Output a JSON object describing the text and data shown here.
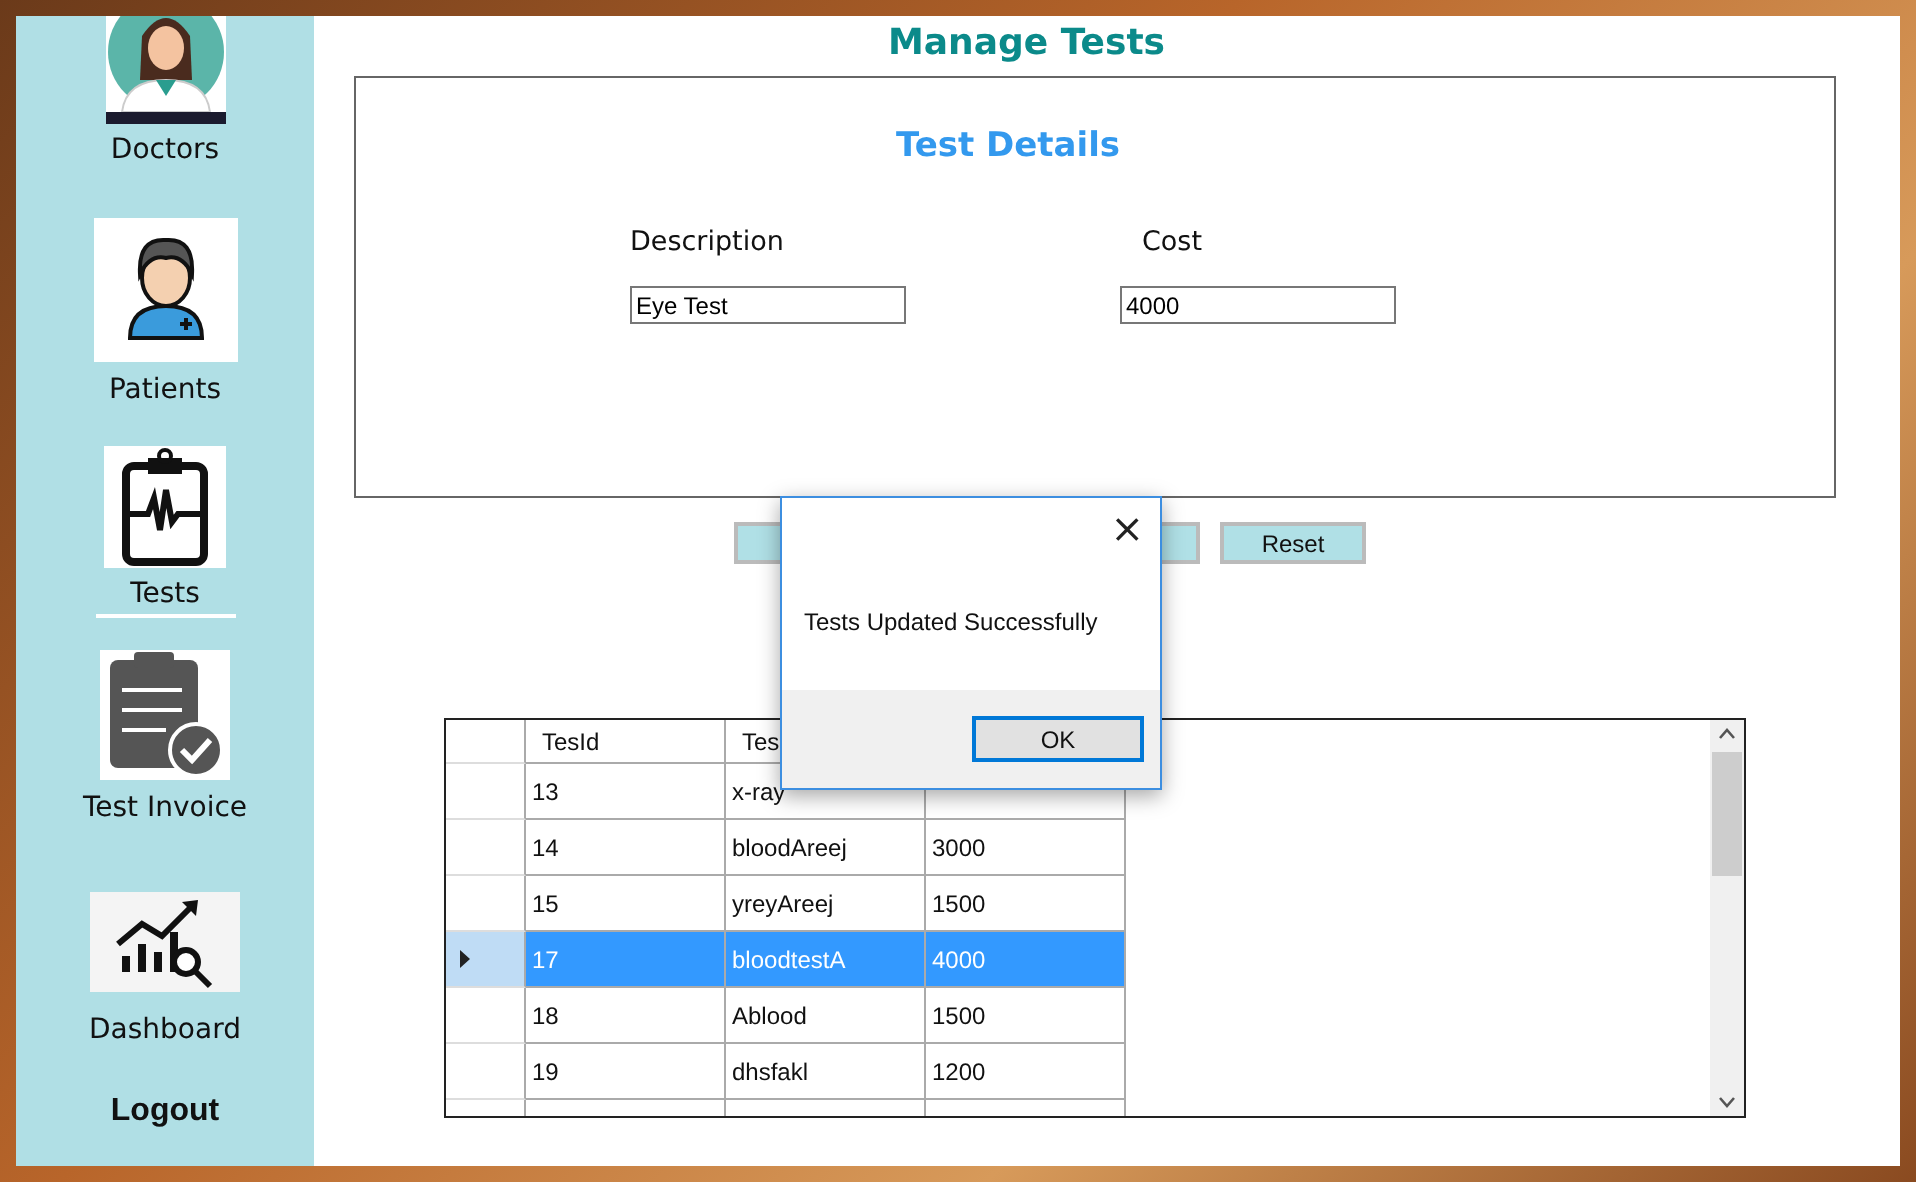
{
  "sidebar": {
    "items": [
      {
        "label": "Doctors",
        "selected": false
      },
      {
        "label": "Patients",
        "selected": false
      },
      {
        "label": "Tests",
        "selected": true
      },
      {
        "label": "Test Invoice",
        "selected": false
      },
      {
        "label": "Dashboard",
        "selected": false
      }
    ],
    "logout": "Logout"
  },
  "title": "Manage Tests",
  "details": {
    "heading": "Test Details",
    "fields": [
      {
        "label": "Description",
        "value": "Eye Test"
      },
      {
        "label": "Cost",
        "value": "4000"
      }
    ]
  },
  "action_buttons": [
    {
      "kind": "covered"
    },
    {
      "kind": "covered"
    },
    {
      "kind": "labeled",
      "label": "Reset"
    }
  ],
  "table": {
    "columns": [
      "TesId",
      "Tes"
    ],
    "rows": [
      {
        "cells": [
          "13",
          "x-ray"
        ],
        "selected": false
      },
      {
        "cells": [
          "14",
          "bloodAreej",
          "3000"
        ],
        "selected": false
      },
      {
        "cells": [
          "15",
          "yreyAreej",
          "1500"
        ],
        "selected": false
      },
      {
        "cells": [
          "17",
          "bloodtestA",
          "4000"
        ],
        "selected": true
      },
      {
        "cells": [
          "18",
          "Ablood",
          "1500"
        ],
        "selected": false
      },
      {
        "cells": [
          "19",
          "dhsfakl",
          "1200"
        ],
        "selected": false
      }
    ]
  },
  "dialog": {
    "message": "Tests Updated Successfully",
    "button": "OK",
    "close": "×"
  }
}
